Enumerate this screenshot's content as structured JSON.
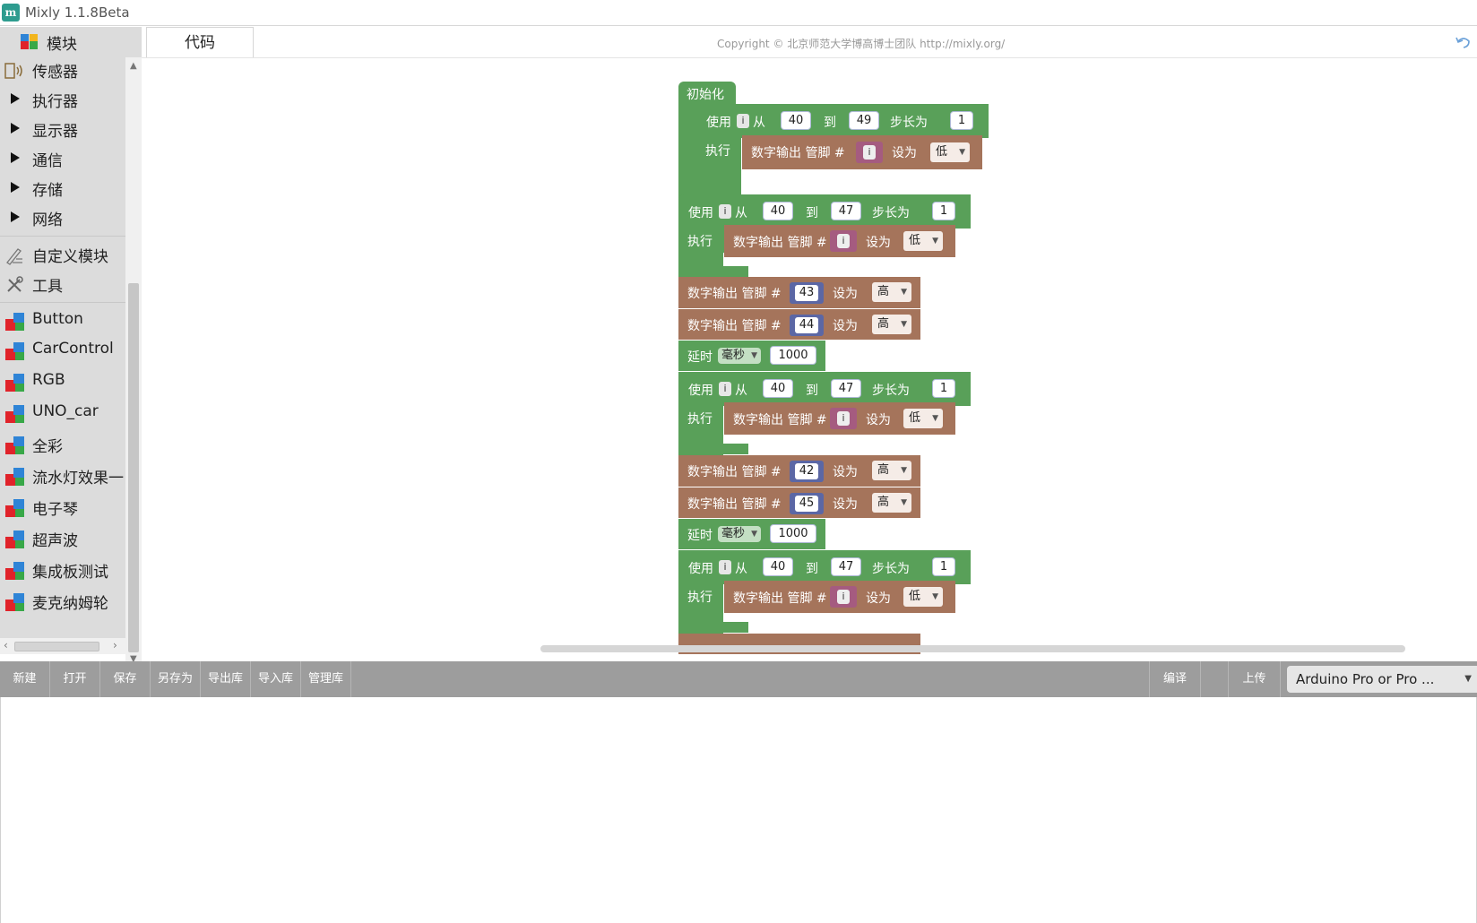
{
  "window": {
    "title": "Mixly 1.1.8Beta",
    "logo": "m"
  },
  "sidebar": {
    "title": "模块",
    "categories": [
      "传感器",
      "执行器",
      "显示器",
      "通信",
      "存储",
      "网络"
    ],
    "tools": [
      "自定义模块",
      "工具"
    ],
    "extensions": [
      "Button",
      "CarControl",
      "RGB",
      "UNO_car",
      "全彩",
      "流水灯效果一",
      "电子琴",
      "超声波",
      "集成板测试",
      "麦克纳姆轮"
    ]
  },
  "workspace": {
    "tab_code": "代码",
    "copyright": "Copyright © 北京师范大学博高博士团队 http://mixly.org/"
  },
  "blocks": {
    "setup_label": "初始化",
    "for_use": "使用",
    "for_var": "i",
    "for_from": "从",
    "for_to": "到",
    "for_step": "步长为",
    "for_do": "执行",
    "digital_write": "数字输出 管脚 #",
    "set_to": "设为",
    "low": "低",
    "high": "高",
    "delay": "延时",
    "ms": "毫秒",
    "loop1": {
      "from": "40",
      "to": "49",
      "step": "1"
    },
    "loop2": {
      "from": "40",
      "to": "47",
      "step": "1"
    },
    "loop3": {
      "from": "40",
      "to": "47",
      "step": "1"
    },
    "loop4": {
      "from": "40",
      "to": "47",
      "step": "1"
    },
    "pins_a": [
      "43",
      "44"
    ],
    "pins_b": [
      "42",
      "45"
    ],
    "delay1": "1000",
    "delay2": "1000"
  },
  "toolbar": {
    "buttons": [
      "新建",
      "打开",
      "保存",
      "另存为",
      "导出库",
      "导入库",
      "管理库"
    ],
    "compile": "编译",
    "upload": "上传",
    "board": "Arduino Pro or Pro ..."
  },
  "colors": {
    "loop_green": "#59a059",
    "io_brown": "#a5745b",
    "toolbar": "#9d9d9d"
  },
  "icons": [
    "puzzle-icon",
    "sensor-icon",
    "pencil-icon",
    "tools-icon",
    "extension-icon",
    "undo-icon"
  ]
}
